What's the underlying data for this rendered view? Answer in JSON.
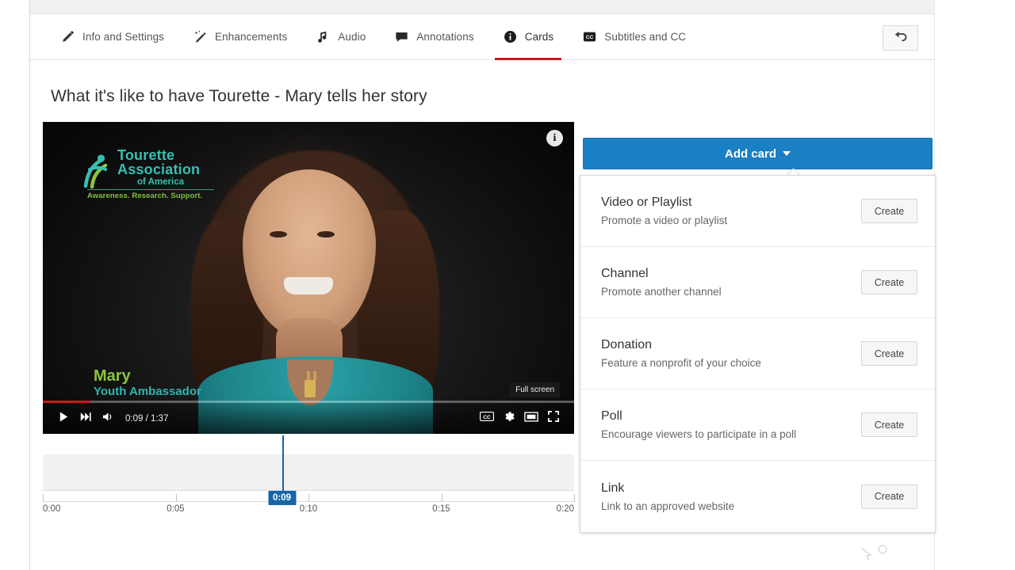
{
  "tabs": [
    {
      "label": "Info and Settings",
      "icon": "pencil-icon",
      "active": false
    },
    {
      "label": "Enhancements",
      "icon": "magic-wand-icon",
      "active": false
    },
    {
      "label": "Audio",
      "icon": "music-note-icon",
      "active": false
    },
    {
      "label": "Annotations",
      "icon": "speech-bubble-icon",
      "active": false
    },
    {
      "label": "Cards",
      "icon": "info-circle-icon",
      "active": true
    },
    {
      "label": "Subtitles and CC",
      "icon": "cc-icon",
      "active": false
    }
  ],
  "header": {
    "back_button_icon": "back-arrow-icon",
    "video_title": "What it's like to have Tourette - Mary tells her story"
  },
  "player": {
    "info_badge": "i",
    "tooltip": "Full screen",
    "current_time": "0:09",
    "total_time": "1:37",
    "time_display": "0:09 / 1:37",
    "progress_percent": 9,
    "overlay": {
      "logo_line1": "Tourette",
      "logo_line2": "Association",
      "logo_line3": "of America",
      "logo_tagline": "Awareness. Research. Support.",
      "speaker_name": "Mary",
      "speaker_role": "Youth Ambassador"
    },
    "controls_left": [
      {
        "name": "play-button",
        "icon": "play-icon"
      },
      {
        "name": "next-video-button",
        "icon": "next-track-icon"
      },
      {
        "name": "volume-button",
        "icon": "volume-icon"
      }
    ],
    "controls_right": [
      {
        "name": "subtitles-button",
        "icon": "cc-icon"
      },
      {
        "name": "settings-button",
        "icon": "gear-icon"
      },
      {
        "name": "theater-mode-button",
        "icon": "theater-icon"
      },
      {
        "name": "fullscreen-button",
        "icon": "fullscreen-icon"
      }
    ]
  },
  "timeline": {
    "ticks": [
      "0:00",
      "0:05",
      "0:10",
      "0:15",
      "0:20"
    ],
    "tick_positions_pct": [
      0,
      25,
      50,
      75,
      100
    ],
    "playhead_time": "0:09",
    "playhead_position_pct": 45
  },
  "cards_panel": {
    "add_card_label": "Add card",
    "add_card_caret": "chevron-down-icon",
    "accent_color": "#1b7fc4",
    "options": [
      {
        "title": "Video or Playlist",
        "subtitle": "Promote a video or playlist",
        "button": "Create"
      },
      {
        "title": "Channel",
        "subtitle": "Promote another channel",
        "button": "Create"
      },
      {
        "title": "Donation",
        "subtitle": "Feature a nonprofit of your choice",
        "button": "Create"
      },
      {
        "title": "Poll",
        "subtitle": "Encourage viewers to participate in a poll",
        "button": "Create"
      },
      {
        "title": "Link",
        "subtitle": "Link to an approved website",
        "button": "Create"
      }
    ]
  }
}
